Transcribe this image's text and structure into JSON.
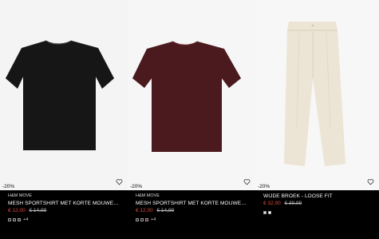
{
  "products": [
    {
      "badge": "-20%",
      "brand": "H&M MOVE",
      "name": "MESH SPORTSHIRT MET KORTE MOUWEN M...",
      "sale_price": "€ 12,00",
      "original_price": "€ 14,99",
      "more_colors": "+4",
      "swatch_colors": [
        "#1b1b1b",
        "#2a2a2a",
        "#3a3a3a"
      ],
      "garment_color": "#161616",
      "icon": "heart-icon"
    },
    {
      "badge": "-20%",
      "brand": "H&M MOVE",
      "name": "MESH SPORTSHIRT MET KORTE MOUWEN M...",
      "sale_price": "€ 12,00",
      "original_price": "€ 14,99",
      "more_colors": "+4",
      "swatch_colors": [
        "#2a2a2a",
        "#1b1b1b",
        "#4a1a1e"
      ],
      "garment_color": "#4a1a1e",
      "icon": "heart-icon"
    },
    {
      "badge": "-20%",
      "brand": "",
      "name": "WIJDE BROEK - LOOSE FIT",
      "sale_price": "€ 32,00",
      "original_price": "€ 39,99",
      "more_colors": "",
      "swatch_colors": [
        "#efe7d6",
        "#ffffff"
      ],
      "garment_color": "#ece4d4",
      "icon": "heart-icon"
    }
  ]
}
